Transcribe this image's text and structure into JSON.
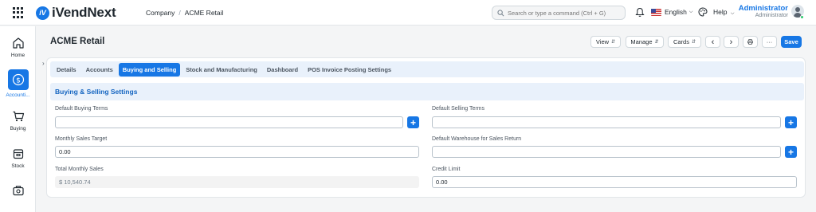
{
  "app": {
    "brand_prefix": "iVend",
    "brand_suffix": "Next",
    "brand_mark": "iV"
  },
  "breadcrumb": {
    "items": [
      "Company",
      "ACME Retail"
    ],
    "separator": "/"
  },
  "search": {
    "placeholder": "Search or type a command (Ctrl + G)"
  },
  "navbar": {
    "language": "English",
    "help": "Help",
    "user_name": "Administrator",
    "user_role": "Administrator"
  },
  "sidebar": {
    "items": [
      {
        "label": "Home",
        "icon": "home-icon"
      },
      {
        "label": "Accounti...",
        "icon": "dollar-icon",
        "active": true
      },
      {
        "label": "Buying",
        "icon": "cart-icon"
      },
      {
        "label": "Stock",
        "icon": "box-icon"
      },
      {
        "label": "",
        "icon": "briefcase-icon"
      }
    ]
  },
  "page": {
    "title": "ACME Retail"
  },
  "toolbar": {
    "view": "View",
    "manage": "Manage",
    "cards": "Cards",
    "prev": "‹",
    "next": "›",
    "print": "⎙",
    "more": "···",
    "save": "Save"
  },
  "tabs": [
    {
      "label": "Details"
    },
    {
      "label": "Accounts"
    },
    {
      "label": "Buying and Selling",
      "active": true
    },
    {
      "label": "Stock and Manufacturing"
    },
    {
      "label": "Dashboard"
    },
    {
      "label": "POS Invoice Posting Settings"
    }
  ],
  "section": {
    "title": "Buying & Selling Settings"
  },
  "fields": {
    "default_buying_terms": {
      "label": "Default Buying Terms",
      "value": ""
    },
    "default_selling_terms": {
      "label": "Default Selling Terms",
      "value": ""
    },
    "monthly_sales_target": {
      "label": "Monthly Sales Target",
      "value": "0.00"
    },
    "default_warehouse_sales_return": {
      "label": "Default Warehouse for Sales Return",
      "value": ""
    },
    "total_monthly_sales": {
      "label": "Total Monthly Sales",
      "value": "$ 10,540.74"
    },
    "credit_limit": {
      "label": "Credit Limit",
      "value": "0.00"
    }
  },
  "colors": {
    "primary": "#1777e5",
    "section_bg": "#e9f1fb",
    "online": "#2ecc71"
  }
}
